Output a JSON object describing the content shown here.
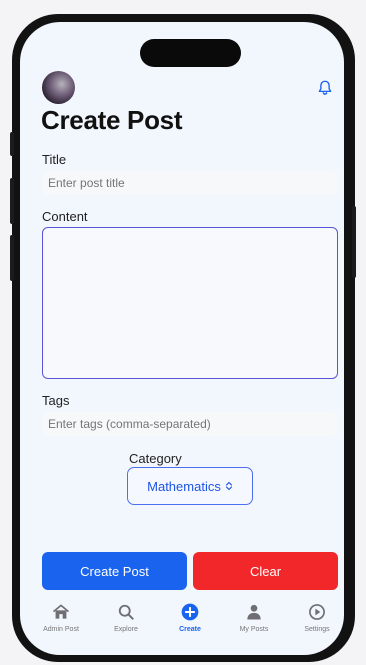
{
  "header": {
    "title": "Create Post"
  },
  "form": {
    "title_label": "Title",
    "title_placeholder": "Enter post title",
    "content_label": "Content",
    "content_value": "",
    "tags_label": "Tags",
    "tags_placeholder": "Enter tags (comma-separated)",
    "category_label": "Category",
    "category_value": "Mathematics",
    "create_button": "Create Post",
    "clear_button": "Clear"
  },
  "colors": {
    "accent": "#1a63ee",
    "primary_button": "#1a63ee",
    "danger_button": "#f2272a"
  },
  "tabs": [
    {
      "label": "Admin Post",
      "icon": "home-icon",
      "active": false
    },
    {
      "label": "Explore",
      "icon": "search-icon",
      "active": false
    },
    {
      "label": "Create",
      "icon": "plus-circle-icon",
      "active": true
    },
    {
      "label": "My Posts",
      "icon": "person-icon",
      "active": false
    },
    {
      "label": "Settings",
      "icon": "settings-icon",
      "active": false
    }
  ]
}
